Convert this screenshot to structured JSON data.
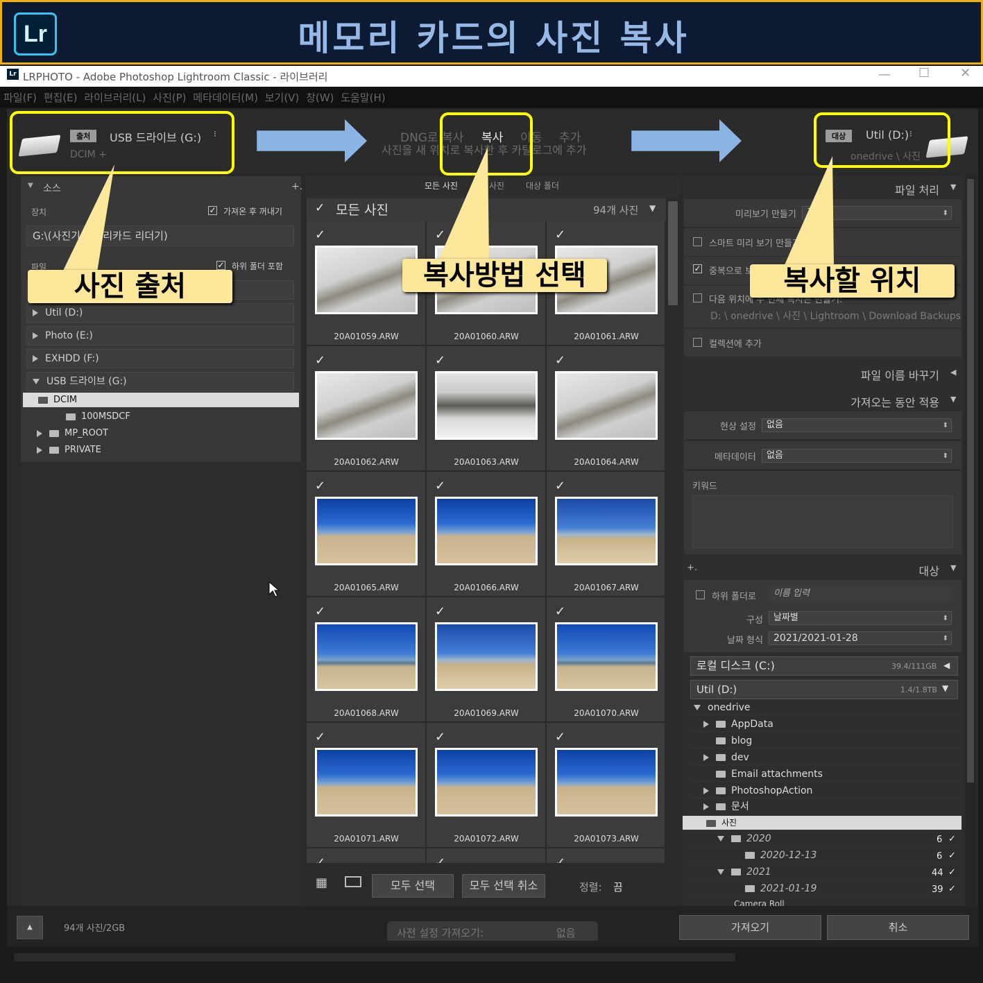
{
  "banner": {
    "logo": "Lr",
    "title": "메모리 카드의 사진 복사"
  },
  "window": {
    "title": "LRPHOTO - Adobe Photoshop Lightroom Classic - 라이브러리",
    "icon": "Lr"
  },
  "menu": [
    "파일(F)",
    "편집(E)",
    "라이브러리(L)",
    "사진(P)",
    "메타데이터(M)",
    "보기(V)",
    "창(W)",
    "도움말(H)"
  ],
  "source": {
    "tag": "출처",
    "drive": "USB 드라이브 (G:)",
    "path": "DCIM +"
  },
  "modes": {
    "dng": "DNG로 복사",
    "copy": "복사",
    "move": "이동",
    "add": "추가",
    "desc": "사진을 새 위치로 복사한 후 카탈로그에 추가"
  },
  "dest": {
    "tag": "대상",
    "drive": "Util (D:)",
    "path": "onedrive \\ 사진"
  },
  "left": {
    "section": "소스",
    "device_label": "장치",
    "eject_label": "가져온 후 꺼내기",
    "device_value": "G:\\(사진기 메모리카드 리더기)",
    "files_label": "파일",
    "subfolder_label": "하위 폴더 포함",
    "drives": [
      "Util (D:)",
      "Photo (E:)",
      "EXHDD (F:)",
      "USB 드라이브 (G:)"
    ],
    "folders": [
      "DCIM",
      "100MSDCF",
      "MP_ROOT",
      "PRIVATE"
    ]
  },
  "grid": {
    "tabs": [
      "모든 사진",
      "새 사진",
      "대상 폴더"
    ],
    "header": "모든 사진",
    "count": "94개 사진",
    "files": [
      "20A01059.ARW",
      "20A01060.ARW",
      "20A01061.ARW",
      "20A01062.ARW",
      "20A01063.ARW",
      "20A01064.ARW",
      "20A01065.ARW",
      "20A01066.ARW",
      "20A01067.ARW",
      "20A01068.ARW",
      "20A01069.ARW",
      "20A01070.ARW",
      "20A01071.ARW",
      "20A01072.ARW",
      "20A01073.ARW"
    ],
    "select_all": "모두 선택",
    "deselect_all": "모두 선택 취소",
    "sort_label": "정렬:",
    "sort_value": "끔"
  },
  "right": {
    "file_handling": "파일 처리",
    "preview_label": "미리보기 만들기",
    "preview_value": "표준",
    "smart_preview": "스마트 미리 보기 만들기",
    "no_dup": "중복으로 보이는 사진 가져오지 않기",
    "second_copy": "다음 위치에 두 번째 복사본 만들기:",
    "second_path": "D: \\ onedrive \\ 사진 \\ Lightroom \\ Download Backups",
    "add_collection": "컬렉션에 추가",
    "rename": "파일 이름 바꾸기",
    "apply": "가져오는 동안 적용",
    "develop_label": "현상 설정",
    "develop_value": "없음",
    "meta_label": "메타데이터",
    "meta_value": "없음",
    "keyword_label": "키워드",
    "dest_section": "대상",
    "subfolder_label": "하위 폴더로",
    "subfolder_placeholder": "이름 입력",
    "org_label": "구성",
    "org_value": "날짜별",
    "date_label": "날짜 형식",
    "date_value": "2021/2021-01-28",
    "disk1": "로컬 디스크 (C:)",
    "disk1_size": "39.4/111GB",
    "disk2": "Util (D:)",
    "disk2_size": "1.4/1.8TB",
    "tree": [
      "onedrive",
      "AppData",
      "blog",
      "dev",
      "Email attachments",
      "PhotoshopAction",
      "문서",
      "사진",
      "2020",
      "2020-12-13",
      "2021",
      "2021-01-19",
      "Camera Roll"
    ],
    "counts": [
      "6",
      "6",
      "44",
      "39"
    ]
  },
  "footer": {
    "total": "94개 사진/2GB",
    "preset_label": "사전 설정 가져오기:",
    "preset_value": "없음",
    "import": "가져오기",
    "cancel": "취소"
  },
  "callouts": {
    "source": "사진 출처",
    "method": "복사방법 선택",
    "target": "복사할 위치"
  }
}
